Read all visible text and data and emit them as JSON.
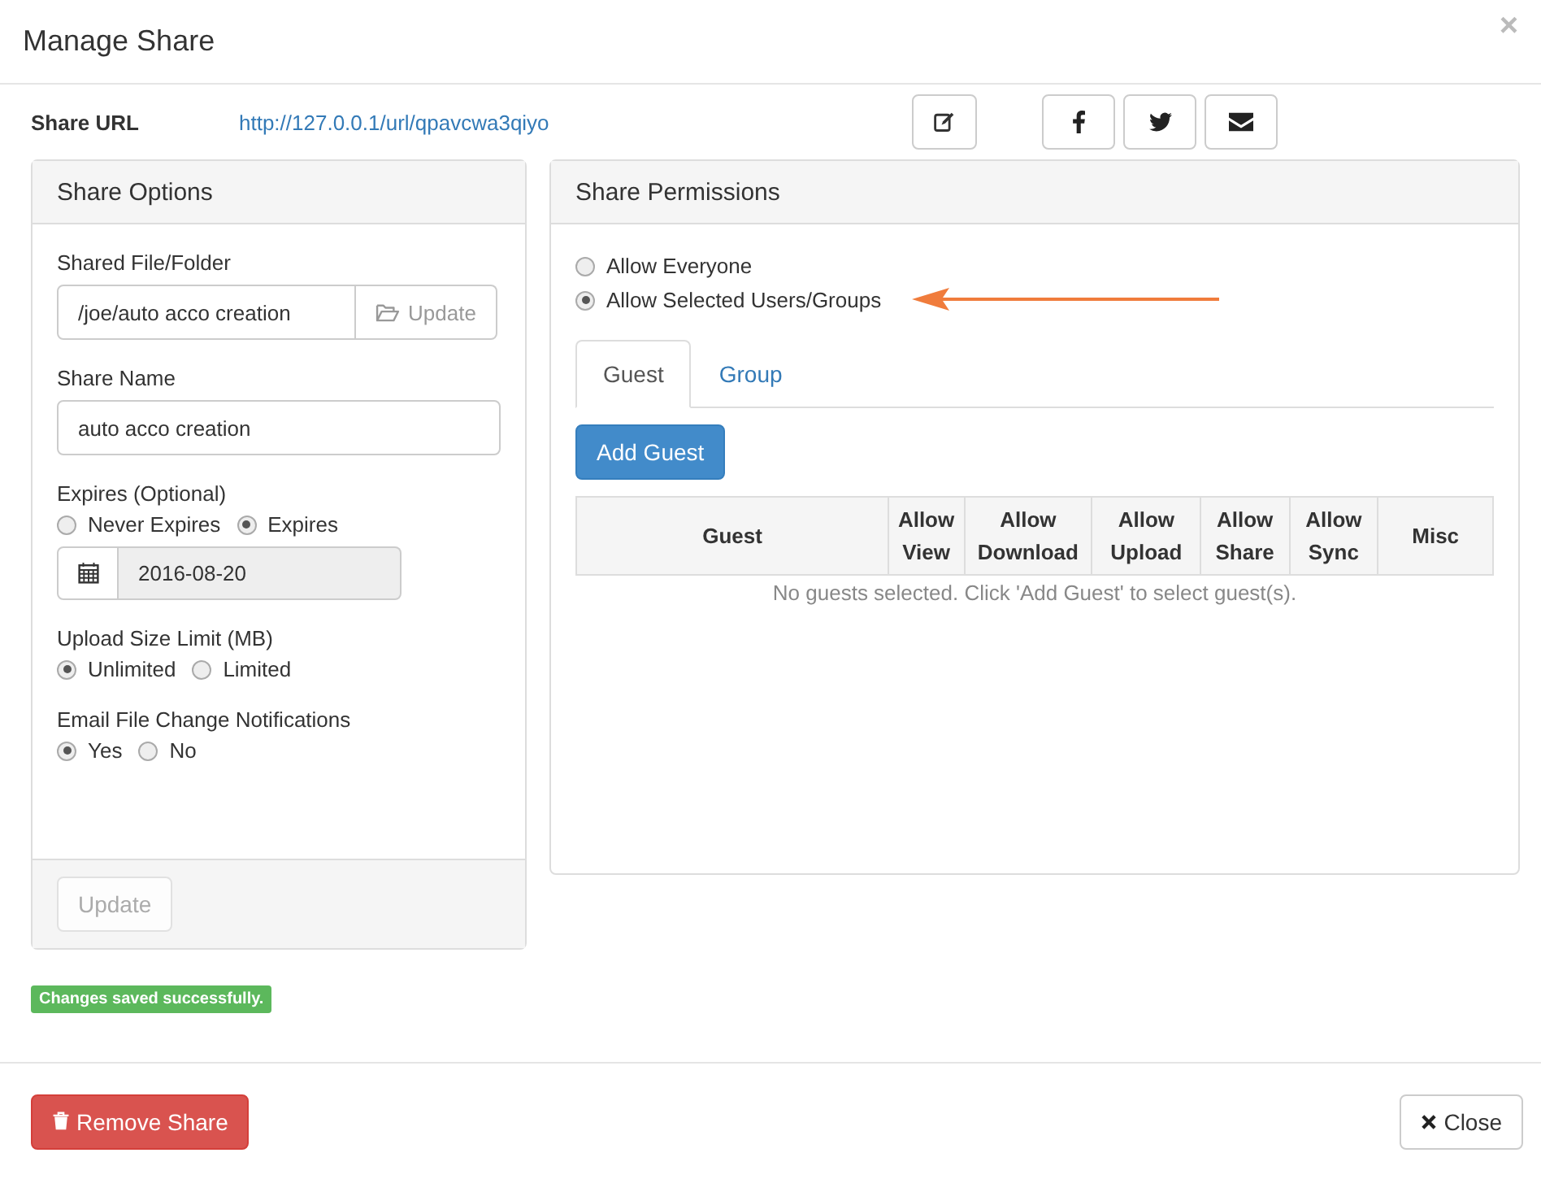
{
  "modal": {
    "title": "Manage Share",
    "close": "×"
  },
  "share_url": {
    "label": "Share URL",
    "url": "http://127.0.0.1/url/qpavcwa3qiyo"
  },
  "share_options": {
    "title": "Share Options",
    "shared_path": {
      "label": "Shared File/Folder",
      "value": "/joe/auto acco creation",
      "button": "Update"
    },
    "share_name": {
      "label": "Share Name",
      "value": "auto acco creation"
    },
    "expires": {
      "label": "Expires (Optional)",
      "options": [
        {
          "label": "Never Expires",
          "selected": false
        },
        {
          "label": "Expires",
          "selected": true
        }
      ],
      "date": "2016-08-20"
    },
    "upload_limit": {
      "label": "Upload Size Limit (MB)",
      "options": [
        {
          "label": "Unlimited",
          "selected": true
        },
        {
          "label": "Limited",
          "selected": false
        }
      ]
    },
    "email_notifications": {
      "label": "Email File Change Notifications",
      "options": [
        {
          "label": "Yes",
          "selected": true
        },
        {
          "label": "No",
          "selected": false
        }
      ]
    },
    "update_button": {
      "label": "Update",
      "disabled": true
    }
  },
  "status": "Changes saved successfully.",
  "share_permissions": {
    "title": "Share Permissions",
    "access": [
      {
        "label": "Allow Everyone",
        "selected": false
      },
      {
        "label": "Allow Selected Users/Groups",
        "selected": true
      }
    ],
    "tabs": [
      {
        "label": "Guest",
        "selected": true
      },
      {
        "label": "Group",
        "selected": false
      }
    ],
    "add_button": "Add Guest",
    "table": {
      "columns": [
        "Guest",
        "Allow View",
        "Allow Download",
        "Allow Upload",
        "Allow Share",
        "Allow Sync",
        "Misc"
      ],
      "empty_message": "No guests selected. Click 'Add Guest' to select guest(s)."
    }
  },
  "footer": {
    "remove_button": "Remove Share",
    "close_button": "Close"
  }
}
